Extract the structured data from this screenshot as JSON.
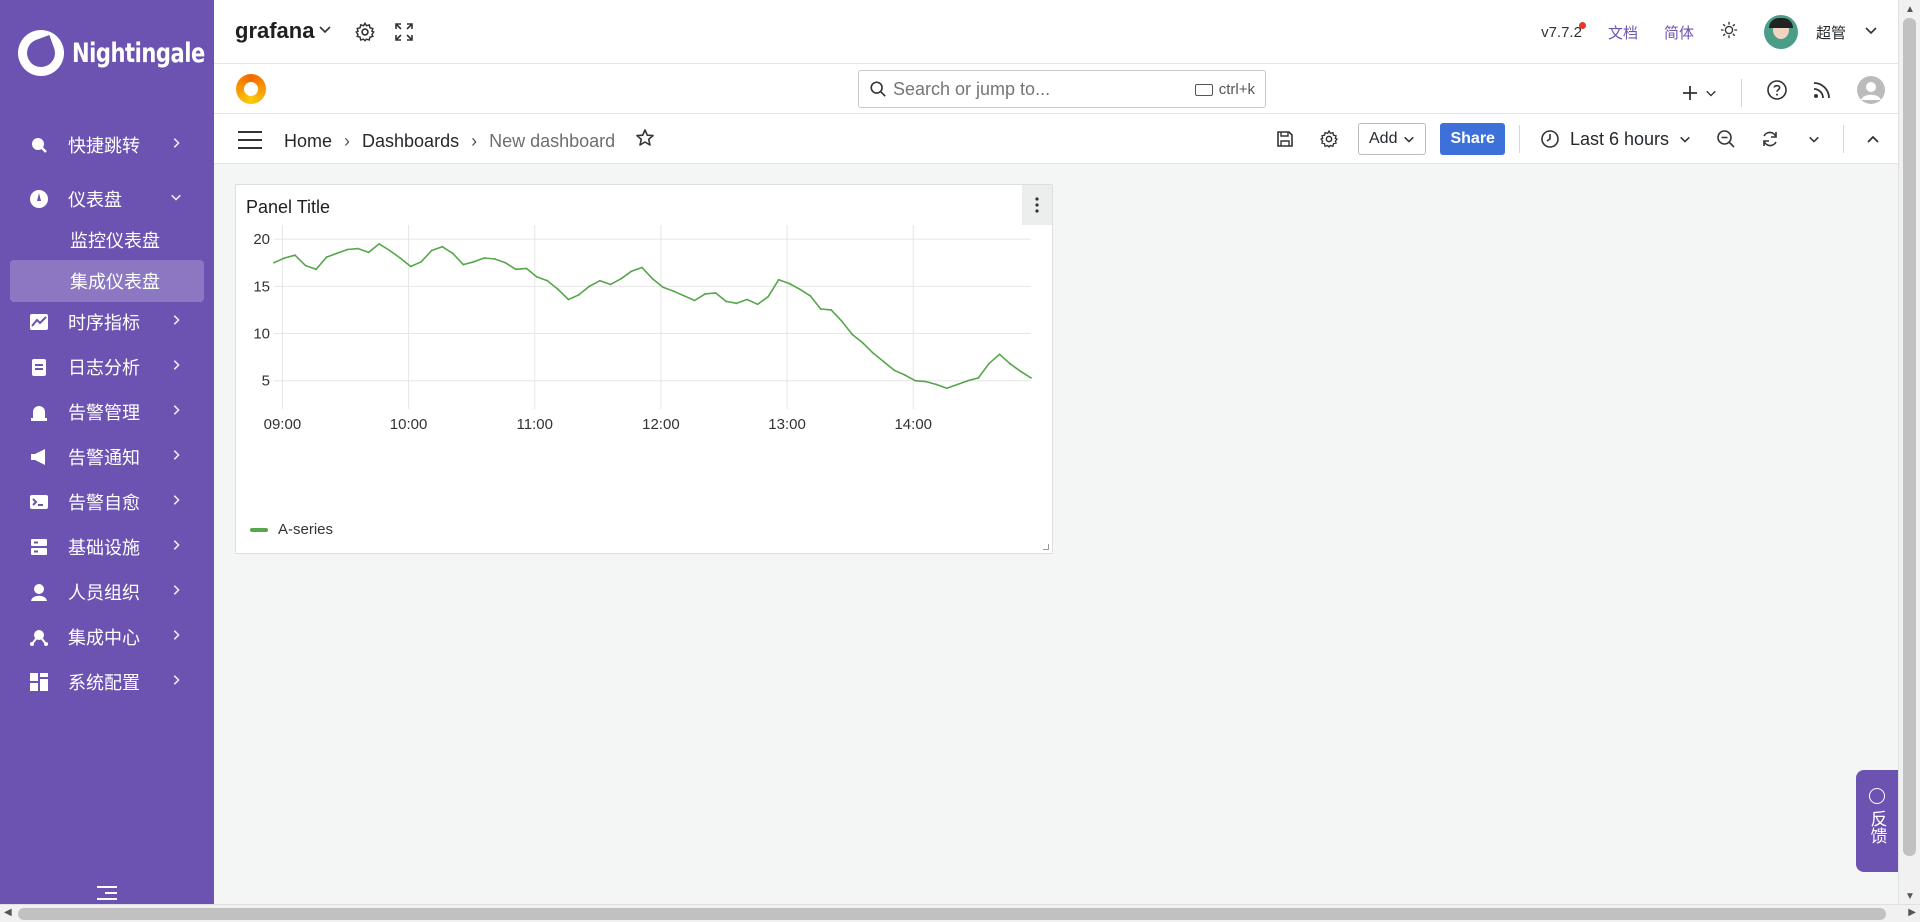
{
  "app": {
    "logo_text": "Nightingale"
  },
  "sidebar": {
    "items": [
      {
        "label": "快捷跳转",
        "icon": "search-icon"
      },
      {
        "label": "仪表盘",
        "icon": "dashboard-gauge-icon",
        "expanded": true
      },
      {
        "label": "监控仪表盘",
        "sub": true
      },
      {
        "label": "集成仪表盘",
        "sub": true,
        "active": true
      },
      {
        "label": "时序指标",
        "icon": "line-chart-icon"
      },
      {
        "label": "日志分析",
        "icon": "log-doc-icon"
      },
      {
        "label": "告警管理",
        "icon": "alarm-bell-icon"
      },
      {
        "label": "告警通知",
        "icon": "megaphone-icon"
      },
      {
        "label": "告警自愈",
        "icon": "terminal-icon"
      },
      {
        "label": "基础设施",
        "icon": "server-icon"
      },
      {
        "label": "人员组织",
        "icon": "user-icon"
      },
      {
        "label": "集成中心",
        "icon": "integration-hub-icon"
      },
      {
        "label": "系统配置",
        "icon": "grid-apps-icon"
      }
    ]
  },
  "topbar": {
    "workspace": "grafana",
    "version": "v7.7.2",
    "docs": "文档",
    "lang": "简体",
    "user": "超管"
  },
  "grafana_toolbar": {
    "search_placeholder": "Search or jump to...",
    "search_shortcut": "ctrl+k"
  },
  "dashboard_toolbar": {
    "breadcrumb": [
      "Home",
      "Dashboards",
      "New dashboard"
    ],
    "add_label": "Add",
    "share_label": "Share",
    "time_range": "Last 6 hours"
  },
  "panel": {
    "title": "Panel Title",
    "legend": "A-series"
  },
  "feedback_label": "反馈",
  "colors": {
    "sidebar": "#6c53b1",
    "series": "#56a64b",
    "share_button": "#3d71d9"
  },
  "chart_data": {
    "type": "line",
    "title": "Panel Title",
    "xlabel": "",
    "ylabel": "",
    "x_ticks": [
      "09:00",
      "10:00",
      "11:00",
      "12:00",
      "13:00",
      "14:00"
    ],
    "y_ticks": [
      5,
      10,
      15,
      20
    ],
    "ylim": [
      2,
      21.5
    ],
    "grid": true,
    "legend": "bottom-left",
    "series": [
      {
        "name": "A-series",
        "color": "#56a64b",
        "x": [
          "08:56",
          "09:01",
          "09:06",
          "09:11",
          "09:16",
          "09:21",
          "09:26",
          "09:31",
          "09:36",
          "09:41",
          "09:46",
          "09:51",
          "09:56",
          "10:01",
          "10:06",
          "10:11",
          "10:16",
          "10:21",
          "10:26",
          "10:31",
          "10:36",
          "10:41",
          "10:46",
          "10:51",
          "10:56",
          "11:01",
          "11:06",
          "11:11",
          "11:16",
          "11:21",
          "11:26",
          "11:31",
          "11:36",
          "11:41",
          "11:46",
          "11:51",
          "11:56",
          "12:01",
          "12:06",
          "12:11",
          "12:16",
          "12:21",
          "12:26",
          "12:31",
          "12:36",
          "12:41",
          "12:46",
          "12:51",
          "12:56",
          "13:01",
          "13:06",
          "13:11",
          "13:16",
          "13:21",
          "13:26",
          "13:31",
          "13:36",
          "13:41",
          "13:46",
          "13:51",
          "13:56",
          "14:01",
          "14:06",
          "14:11",
          "14:16",
          "14:21",
          "14:26",
          "14:31",
          "14:36",
          "14:41",
          "14:46",
          "14:51",
          "14:56"
        ],
        "values": [
          17.5,
          18.0,
          18.3,
          17.2,
          16.8,
          18.1,
          18.5,
          18.9,
          19.0,
          18.6,
          19.5,
          18.8,
          18.0,
          17.1,
          17.6,
          18.8,
          19.2,
          18.5,
          17.3,
          17.6,
          18.0,
          17.9,
          17.5,
          16.8,
          16.9,
          16.0,
          15.6,
          14.7,
          13.6,
          14.1,
          15.0,
          15.6,
          15.2,
          15.8,
          16.6,
          17.0,
          15.8,
          14.9,
          14.5,
          14.0,
          13.5,
          14.2,
          14.3,
          13.4,
          13.2,
          13.6,
          13.1,
          13.9,
          15.7,
          15.3,
          14.7,
          14.0,
          12.6,
          12.5,
          11.3,
          9.9,
          9.0,
          7.9,
          7.0,
          6.1,
          5.6,
          5.0,
          4.9,
          4.6,
          4.2,
          4.6,
          5.0,
          5.3,
          6.8,
          7.8,
          6.8,
          6.0,
          5.3
        ]
      }
    ]
  }
}
